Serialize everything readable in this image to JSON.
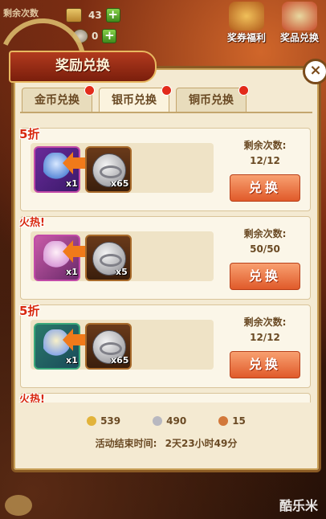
{
  "resources": {
    "label": "剩余次数",
    "gold_count": "43",
    "silver_count": "0"
  },
  "top_buttons": [
    {
      "label": "奖券福利",
      "icon": "ticket-welfare-icon"
    },
    {
      "label": "奖品兑换",
      "icon": "prize-exchange-icon"
    }
  ],
  "panel": {
    "title": "奖励兑换",
    "close_symbol": "×",
    "tabs": [
      {
        "label": "金币兑换",
        "active": false,
        "dot": true
      },
      {
        "label": "银币兑换",
        "active": true,
        "dot": true
      },
      {
        "label": "铜币兑换",
        "active": false,
        "dot": true
      }
    ],
    "offers": [
      {
        "tag": "5折",
        "item_qty": "x1",
        "cost_qty": "x65",
        "remain_label": "剩余次数:",
        "remain": "12/12",
        "button": "兑换",
        "hero_color": "purple"
      },
      {
        "tag": "火热!",
        "item_qty": "x1",
        "cost_qty": "x5",
        "remain_label": "剩余次数:",
        "remain": "50/50",
        "button": "兑换",
        "hero_color": "pink"
      },
      {
        "tag": "5折",
        "item_qty": "x1",
        "cost_qty": "x65",
        "remain_label": "剩余次数:",
        "remain": "12/12",
        "button": "兑换",
        "hero_color": "teal"
      },
      {
        "tag": "火热!"
      }
    ],
    "balances": [
      {
        "value": "539",
        "color": "#e2b33a"
      },
      {
        "value": "490",
        "color": "#b8b8c0"
      },
      {
        "value": "15",
        "color": "#d2783a"
      }
    ],
    "end_time_label": "活动结束时间:",
    "end_time_value": "2天23小时49分"
  },
  "watermark": "酷乐米"
}
